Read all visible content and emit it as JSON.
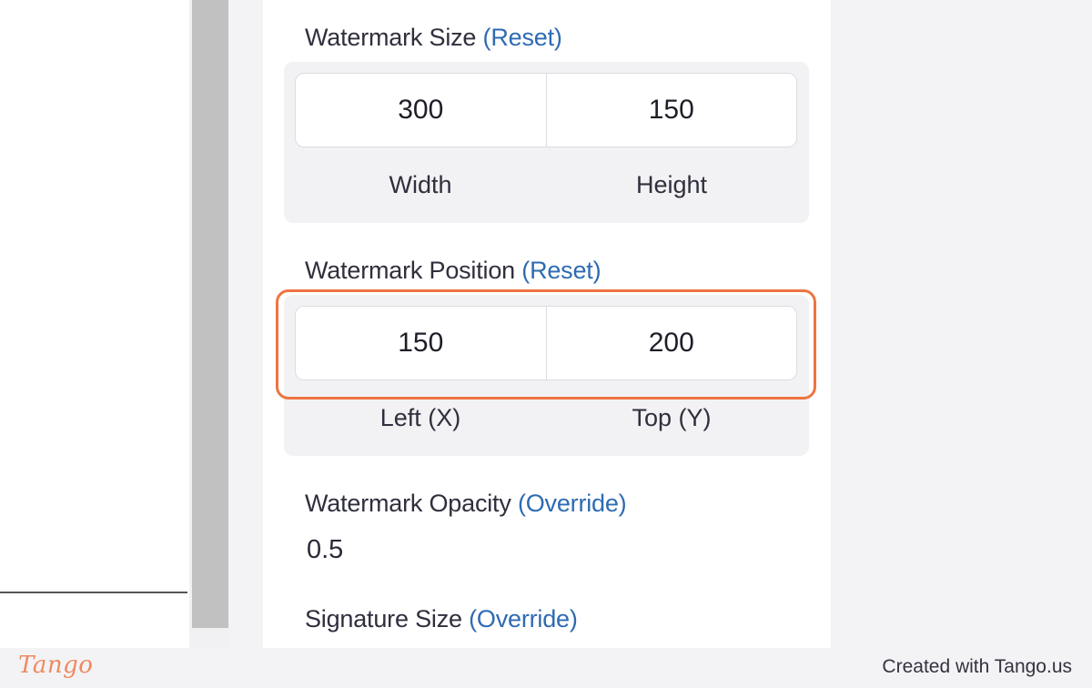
{
  "watermark_size": {
    "label": "Watermark Size",
    "link": "(Reset)",
    "width_value": "300",
    "height_value": "150",
    "width_label": "Width",
    "height_label": "Height"
  },
  "watermark_position": {
    "label": "Watermark Position",
    "link": "(Reset)",
    "left_value": "150",
    "top_value": "200",
    "left_label": "Left (X)",
    "top_label": "Top (Y)"
  },
  "watermark_opacity": {
    "label": "Watermark Opacity",
    "link": "(Override)",
    "value": "0.5"
  },
  "signature_size": {
    "label": "Signature Size",
    "link": "(Override)"
  },
  "footer": {
    "logo": "Tango",
    "credit": "Created with Tango.us"
  },
  "colors": {
    "link": "#2e6bb2",
    "highlight": "#ee7441",
    "brand": "#ef8a5e"
  }
}
